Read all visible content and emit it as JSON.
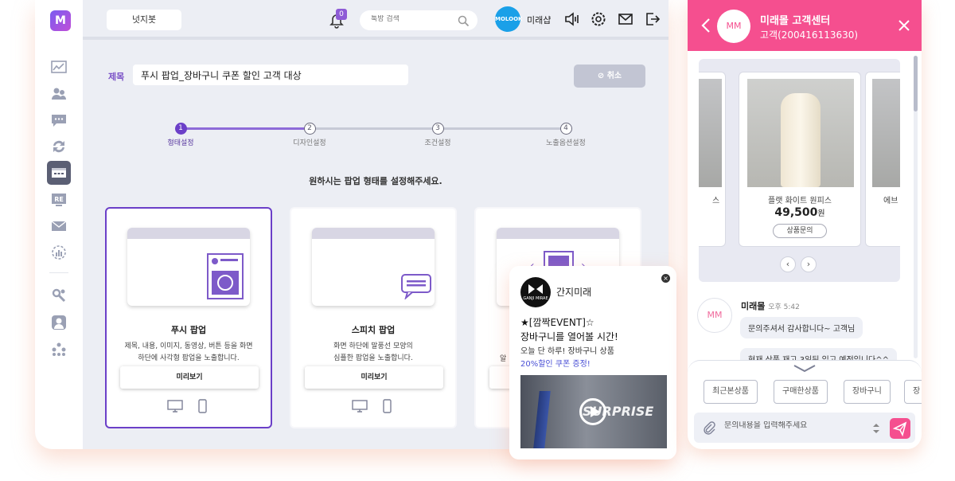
{
  "admin": {
    "logo_text": "M",
    "topbar": {
      "nudge_button": "넛지봇",
      "notification_count": "0",
      "search_placeholder": "툭방 검색",
      "shop_logo_text": "MOLOOK",
      "shop_name": "미래샵"
    },
    "sidebar": {
      "items": [
        "dashboard-icon",
        "customers-icon",
        "chat-icon",
        "refresh-icon",
        "popup-icon",
        "re-icon",
        "mail-icon",
        "analytics-icon",
        "settings-tools-icon",
        "profile-icon",
        "network-icon"
      ],
      "active_index": 4
    },
    "form": {
      "title_label": "제목",
      "title_value": "푸시 팝업_장바구니 쿠폰 할인 고객 대상",
      "cancel_button": "취소"
    },
    "steps": [
      {
        "num": "1",
        "label": "형태설정",
        "active": true
      },
      {
        "num": "2",
        "label": "디자인설정",
        "active": false
      },
      {
        "num": "3",
        "label": "조건설정",
        "active": false
      },
      {
        "num": "4",
        "label": "노출옵션설정",
        "active": false
      }
    ],
    "instruction": "원하시는 팝업 형태를 설정해주세요.",
    "cards": [
      {
        "name": "푸시 팝업",
        "desc_line1": "제목, 내용, 이미지, 동영상, 버튼 등을 화면",
        "desc_line2": "하단에 사각형 팝업을 노출합니다.",
        "preview": "미리보기",
        "selected": true
      },
      {
        "name": "스피치 팝업",
        "desc_line1": "화면 하단에 말풍선 모양의",
        "desc_line2": "심플한 팝업을 노출합니다.",
        "preview": "미리보기",
        "selected": false
      },
      {
        "name": "",
        "desc_line1": "알",
        "desc_line2": "",
        "preview": "",
        "selected": false
      }
    ]
  },
  "push_popup": {
    "brand_logo_text": "GANJI MIRAE",
    "brand_name": "간지미래",
    "line1": "★[깜짝EVENT]☆",
    "line2": "장바구니를 열어볼 시간!",
    "line3": "오늘 단 하루! 장바구니 상품",
    "line4": "20%할인 쿠폰 증정!",
    "image_text": "SURPRISE"
  },
  "chat": {
    "header": {
      "avatar": "MM",
      "title": "미래몰 고객센터",
      "subtitle": "고객(200416113630)"
    },
    "carousel": {
      "left_partial_text": "스",
      "product": {
        "name": "플랫 화이트 원피스",
        "price": "49,500",
        "currency": "원",
        "ask_button": "상품문의"
      },
      "right_partial_text": "에브"
    },
    "message": {
      "avatar": "MM",
      "sender": "미래몰",
      "time": "오후 5:42",
      "bubble1": "문의주셔서 감사합니다~ 고객님",
      "bubble2": "현재 상품 재고 3일뒤 입고 예정입니다^^"
    },
    "quick_buttons": [
      "최근본상품",
      "구매한상품",
      "장바구니",
      "장"
    ],
    "input_placeholder": "문의내용을 입력해주세요"
  },
  "colors": {
    "accent": "#6b3fc8",
    "chat_brand": "#f54f8f",
    "link_blue": "#4b50d6"
  }
}
